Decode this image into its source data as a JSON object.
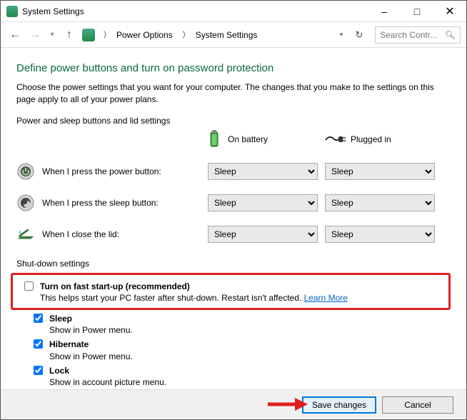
{
  "window": {
    "title": "System Settings"
  },
  "nav": {
    "crumb1": "Power Options",
    "crumb2": "System Settings",
    "search_placeholder": "Search Contr..."
  },
  "page": {
    "heading": "Define power buttons and turn on password protection",
    "description": "Choose the power settings that you want for your computer. The changes that you make to the settings on this page apply to all of your power plans.",
    "section_buttons": "Power and sleep buttons and lid settings",
    "col_battery": "On battery",
    "col_plugged": "Plugged in",
    "rows": {
      "power_button": "When I press the power button:",
      "sleep_button": "When I press the sleep button:",
      "close_lid": "When I close the lid:"
    },
    "select_value": "Sleep",
    "section_shutdown": "Shut-down settings",
    "fast_startup": {
      "title": "Turn on fast start-up (recommended)",
      "sub": "This helps start your PC faster after shut-down. Restart isn't affected. ",
      "learn": "Learn More"
    },
    "sleep": {
      "title": "Sleep",
      "sub": "Show in Power menu."
    },
    "hibernate": {
      "title": "Hibernate",
      "sub": "Show in Power menu."
    },
    "lock": {
      "title": "Lock",
      "sub": "Show in account picture menu."
    }
  },
  "footer": {
    "save": "Save changes",
    "cancel": "Cancel"
  }
}
